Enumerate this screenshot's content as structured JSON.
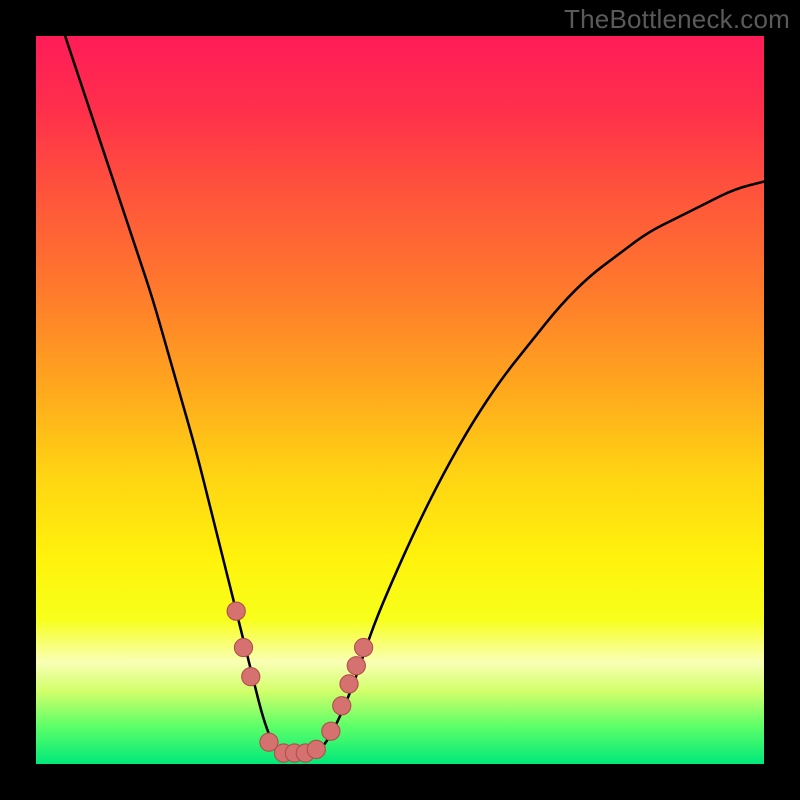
{
  "watermark": "TheBottleneck.com",
  "colors": {
    "frame_bg": "#000000",
    "gradient_stops": [
      {
        "offset": 0.0,
        "color": "#ff1c58"
      },
      {
        "offset": 0.1,
        "color": "#ff2f4b"
      },
      {
        "offset": 0.22,
        "color": "#ff553b"
      },
      {
        "offset": 0.35,
        "color": "#ff7a2c"
      },
      {
        "offset": 0.48,
        "color": "#ffa61e"
      },
      {
        "offset": 0.6,
        "color": "#ffd313"
      },
      {
        "offset": 0.72,
        "color": "#fff30c"
      },
      {
        "offset": 0.8,
        "color": "#f7ff1a"
      },
      {
        "offset": 0.86,
        "color": "#f9ffb5"
      },
      {
        "offset": 0.9,
        "color": "#d2ff6a"
      },
      {
        "offset": 0.95,
        "color": "#59ff69"
      },
      {
        "offset": 1.0,
        "color": "#00e87a"
      }
    ],
    "curve_stroke": "#000000",
    "marker_fill": "#d5716f",
    "marker_stroke": "#b04f4c"
  },
  "chart_data": {
    "type": "line",
    "title": "",
    "xlabel": "",
    "ylabel": "",
    "xlim": [
      0,
      100
    ],
    "ylim": [
      0,
      100
    ],
    "series": [
      {
        "name": "curve",
        "x": [
          4,
          6,
          8,
          10,
          12,
          14,
          16,
          18,
          20,
          22,
          24,
          26,
          27,
          28,
          29,
          30,
          31,
          32,
          33,
          34,
          36,
          38,
          40,
          42,
          44,
          46,
          48,
          52,
          56,
          60,
          64,
          68,
          72,
          76,
          80,
          84,
          88,
          92,
          96,
          100
        ],
        "values": [
          100,
          94,
          88,
          82,
          76,
          70,
          64,
          57,
          50,
          43,
          35,
          27,
          23,
          19,
          15,
          11,
          7,
          4,
          2,
          1,
          1,
          1,
          3,
          7,
          12,
          18,
          23,
          32,
          40,
          47,
          53,
          58,
          63,
          67,
          70,
          73,
          75,
          77,
          79,
          80
        ]
      }
    ],
    "markers": [
      {
        "x": 27.5,
        "y": 21.0
      },
      {
        "x": 28.5,
        "y": 16.0
      },
      {
        "x": 29.5,
        "y": 12.0
      },
      {
        "x": 32.0,
        "y": 3.0
      },
      {
        "x": 34.0,
        "y": 1.5
      },
      {
        "x": 35.5,
        "y": 1.5
      },
      {
        "x": 37.0,
        "y": 1.5
      },
      {
        "x": 38.5,
        "y": 2.0
      },
      {
        "x": 40.5,
        "y": 4.5
      },
      {
        "x": 42.0,
        "y": 8.0
      },
      {
        "x": 43.0,
        "y": 11.0
      },
      {
        "x": 44.0,
        "y": 13.5
      },
      {
        "x": 45.0,
        "y": 16.0
      }
    ]
  }
}
